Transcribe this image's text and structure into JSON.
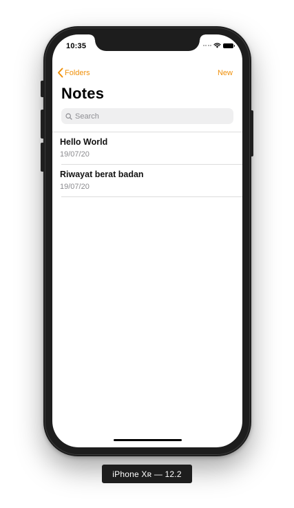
{
  "device": {
    "label": "iPhone Xʀ — 12.2"
  },
  "status_bar": {
    "time": "10:35"
  },
  "nav": {
    "back_label": "Folders",
    "new_label": "New"
  },
  "page": {
    "title": "Notes"
  },
  "search": {
    "placeholder": "Search"
  },
  "notes": [
    {
      "title": "Hello World",
      "date": "19/07/20"
    },
    {
      "title": "Riwayat berat badan",
      "date": "19/07/20"
    }
  ],
  "colors": {
    "accent": "#f0900a",
    "device_frame": "#1d1d1d",
    "search_bg": "#efeff0",
    "secondary_text": "#8a8a8e"
  },
  "icons": {
    "back": "chevron-left-icon",
    "search": "magnifier-icon",
    "wifi": "wifi-icon",
    "battery": "battery-icon"
  }
}
